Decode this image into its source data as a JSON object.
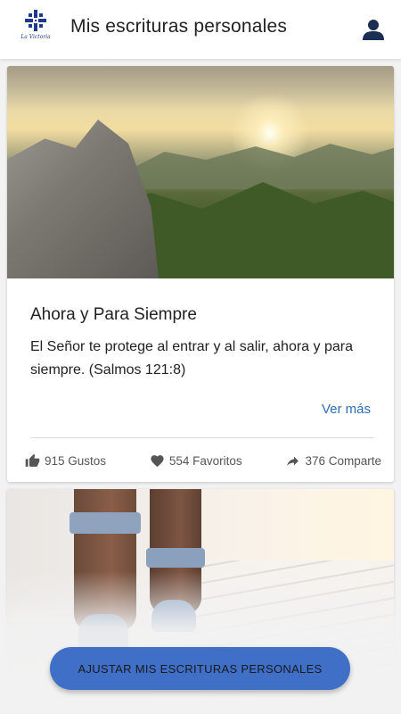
{
  "header": {
    "title": "Mis escrituras personales",
    "logo_text": "La Victoria",
    "logo_icon": "church-cross-logo",
    "profile_icon": "user-icon"
  },
  "cards": [
    {
      "title": "Ahora y Para Siempre",
      "text": "El Señor te protege al entrar y al salir, ahora y para siempre. (Salmos 121:8)",
      "more_label": "Ver más",
      "likes": "915 Gustos",
      "favorites": "554 Favoritos",
      "shares": "376 Comparte"
    }
  ],
  "cta_label": "AJUSTAR MIS ESCRITURAS PERSONALES",
  "colors": {
    "accent": "#3f6fc6",
    "link": "#2f6db5",
    "logo": "#1f3a8a"
  }
}
